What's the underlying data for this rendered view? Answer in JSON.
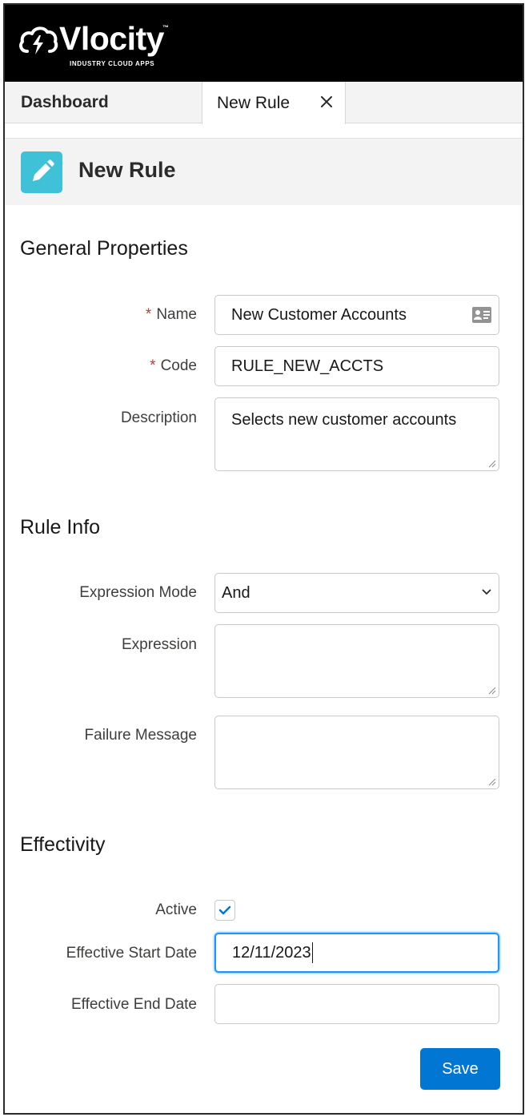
{
  "brand": {
    "name": "Vlocity",
    "tagline": "INDUSTRY CLOUD APPS",
    "tm": "™"
  },
  "tabs": [
    {
      "label": "Dashboard"
    },
    {
      "label": "New Rule",
      "close_icon": "close-icon"
    }
  ],
  "page": {
    "title": "New Rule",
    "icon": "pencil-icon",
    "icon_color": "#3fc1d7"
  },
  "general": {
    "title": "General Properties",
    "name_label": "Name",
    "name_value": "New Customer Accounts",
    "code_label": "Code",
    "code_value": "RULE_NEW_ACCTS",
    "description_label": "Description",
    "description_value": "Selects new customer accounts",
    "required_mark": "*"
  },
  "rule_info": {
    "title": "Rule Info",
    "expression_mode_label": "Expression Mode",
    "expression_mode_value": "And",
    "expression_label": "Expression",
    "expression_value": "",
    "failure_message_label": "Failure Message",
    "failure_message_value": ""
  },
  "effectivity": {
    "title": "Effectivity",
    "active_label": "Active",
    "active_checked": true,
    "start_date_label": "Effective Start Date",
    "start_date_value": "12/11/2023",
    "end_date_label": "Effective End Date",
    "end_date_value": ""
  },
  "actions": {
    "save_label": "Save",
    "save_color": "#0176d3"
  }
}
